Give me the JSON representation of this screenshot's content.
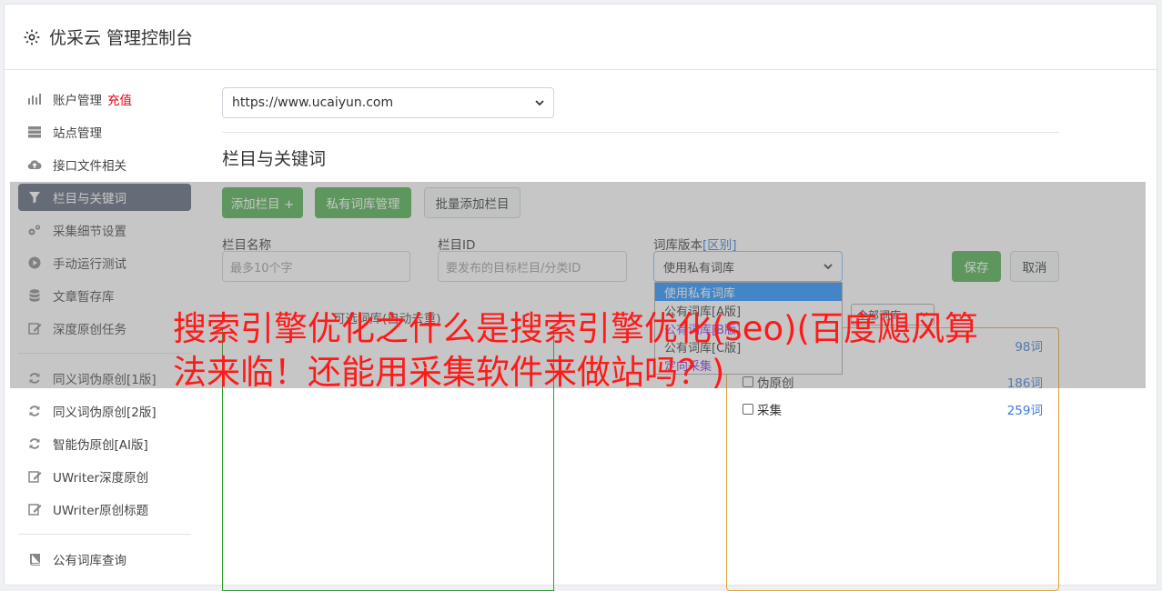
{
  "header": {
    "title": "优采云 管理控制台",
    "icon": "gear-icon"
  },
  "sidebar": {
    "items": [
      {
        "label": "账户管理",
        "extra": "充值",
        "icon": "bar-chart-icon"
      },
      {
        "label": "站点管理",
        "icon": "server-icon"
      },
      {
        "label": "接口文件相关",
        "icon": "cloud-upload-icon"
      },
      {
        "label": "栏目与关键词",
        "icon": "filter-icon",
        "active": true
      },
      {
        "label": "采集细节设置",
        "icon": "cogs-icon"
      },
      {
        "label": "手动运行测试",
        "icon": "play-circle-icon"
      },
      {
        "label": "文章暂存库",
        "icon": "database-icon"
      },
      {
        "label": "深度原创任务",
        "icon": "edit-icon"
      },
      {
        "label": "同义词伪原创[1版]",
        "icon": "refresh-icon"
      },
      {
        "label": "同义词伪原创[2版]",
        "icon": "refresh-icon"
      },
      {
        "label": "智能伪原创[AI版]",
        "icon": "refresh-icon"
      },
      {
        "label": "UWriter深度原创",
        "icon": "edit-icon"
      },
      {
        "label": "UWriter原创标题",
        "icon": "edit-icon"
      },
      {
        "label": "公有词库查询",
        "icon": "book-icon"
      }
    ]
  },
  "main": {
    "site_select": "https://www.ucaiyun.com",
    "section_title": "栏目与关键词",
    "buttons": {
      "add_column": "添加栏目 +",
      "private_lib": "私有词库管理",
      "batch_add": "批量添加栏目",
      "save": "保存",
      "cancel": "取消"
    },
    "fields": {
      "column_name_label": "栏目名称",
      "column_name_placeholder": "最多10个字",
      "column_id_label": "栏目ID",
      "column_id_placeholder": "要发布的目标栏目/分类ID",
      "version_label": "词库版本",
      "version_link": "[区别]",
      "version_value": "使用私有词库"
    },
    "version_options": [
      "使用私有词库",
      "公有词库[A版]",
      "公有词库[B版]",
      "公有词库[C版]",
      "定向采集"
    ],
    "candidate_label": "可选词库(自动去重)",
    "lib_filter": "全部词库",
    "lib_rows": [
      {
        "label": "",
        "count": "98词"
      },
      {
        "label": "伪原创",
        "count": "186词"
      },
      {
        "label": "采集",
        "count": "259词"
      }
    ]
  },
  "overlay_title": "搜索引擎优化之什么是搜索引擎优化(seo)(百度飓风算法来临！还能用采集软件来做站吗？)",
  "colors": {
    "accent_green": "#4cae4c",
    "active_nav": "#5a6577",
    "title_red": "#ff1a1a",
    "recharge_red": "#e60012"
  }
}
